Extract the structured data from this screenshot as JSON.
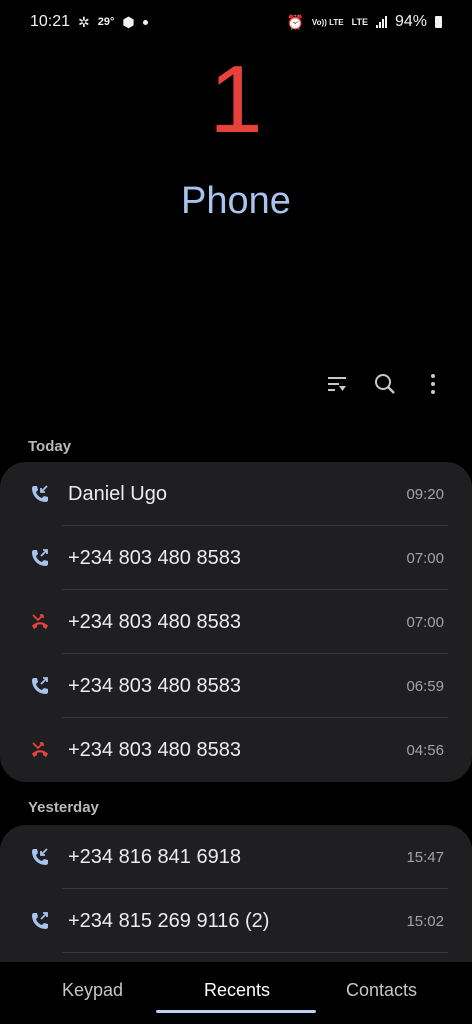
{
  "status": {
    "time": "10:21",
    "temperature": "29°",
    "network": "LTE",
    "volte": "Vo)) LTE",
    "battery": "94%"
  },
  "header": {
    "count": "1",
    "title": "Phone"
  },
  "sections": [
    {
      "label": "Today",
      "calls": [
        {
          "name": "Daniel Ugo",
          "time": "09:20",
          "type": "incoming"
        },
        {
          "name": "+234 803 480 8583",
          "time": "07:00",
          "type": "outgoing"
        },
        {
          "name": "+234 803 480 8583",
          "time": "07:00",
          "type": "missed"
        },
        {
          "name": "+234 803 480 8583",
          "time": "06:59",
          "type": "outgoing"
        },
        {
          "name": "+234 803 480 8583",
          "time": "04:56",
          "type": "missed"
        }
      ]
    },
    {
      "label": "Yesterday",
      "calls": [
        {
          "name": "+234 816 841 6918",
          "time": "15:47",
          "type": "incoming"
        },
        {
          "name": "+234 815 269 9116 (2)",
          "time": "15:02",
          "type": "outgoing"
        }
      ]
    }
  ],
  "nav": {
    "keypad": "Keypad",
    "recents": "Recents",
    "contacts": "Contacts"
  },
  "colors": {
    "accent": "#a7c3ee",
    "missed": "#e8403a",
    "card": "#1f1f21"
  },
  "icons": [
    "filter-icon",
    "search-icon",
    "more-icon",
    "incoming-call-icon",
    "outgoing-call-icon",
    "missed-call-icon"
  ]
}
